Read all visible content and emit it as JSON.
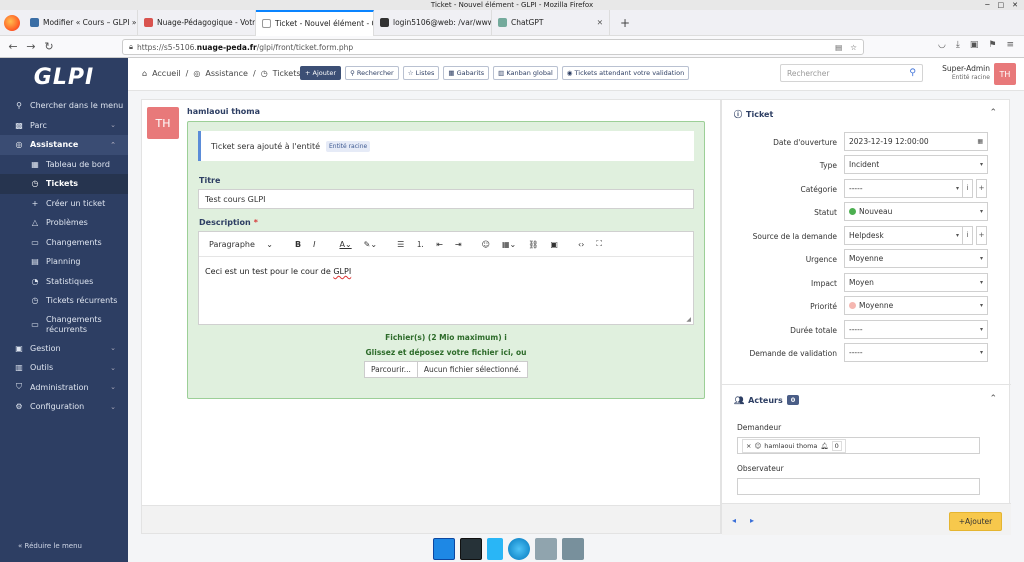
{
  "window": {
    "title": "Ticket - Nouvel élément - GLPI - Mozilla Firefox"
  },
  "browser": {
    "tabs": [
      {
        "label": "Modifier « Cours – GLPI » ‹ s",
        "active": false
      },
      {
        "label": "Nuage-Pédagogique - Votre",
        "active": false
      },
      {
        "label": "Ticket - Nouvel élément - GL",
        "active": true
      },
      {
        "label": "login5106@web: /var/www/",
        "active": false
      },
      {
        "label": "ChatGPT",
        "active": false
      }
    ],
    "url_prefix": "https://s5-5106.",
    "url_domain": "nuage-peda.fr",
    "url_path": "/glpi/front/ticket.form.php"
  },
  "sidebar": {
    "logo": "GLPI",
    "search": "Chercher dans le menu",
    "parc": "Parc",
    "assistance": "Assistance",
    "sub": [
      "Tableau de bord",
      "Tickets",
      "Créer un ticket",
      "Problèmes",
      "Changements",
      "Planning",
      "Statistiques",
      "Tickets récurrents",
      "Changements récurrents"
    ],
    "gestion": "Gestion",
    "outils": "Outils",
    "administration": "Administration",
    "configuration": "Configuration",
    "collapse": "Réduire le menu"
  },
  "header": {
    "breadcrumb": [
      "Accueil",
      "Assistance",
      "Tickets"
    ],
    "actions": [
      "Ajouter",
      "Rechercher",
      "Listes",
      "Gabarits",
      "Kanban global",
      "Tickets attendant votre validation"
    ],
    "search_placeholder": "Rechercher",
    "user_name": "Super-Admin",
    "user_entity": "Entité racine",
    "user_initials": "TH"
  },
  "form": {
    "avatar_initials": "TH",
    "author": "hamlaoui thoma",
    "notice": "Ticket sera ajouté à l'entité",
    "notice_badge": "Entité racine",
    "title_label": "Titre",
    "title_value": "Test cours GLPI",
    "description_label": "Description",
    "required_mark": "*",
    "paragraph": "Paragraphe",
    "editor_text_before": "Ceci est un test pour le cour de ",
    "editor_text_misspelled": "GLPI",
    "files_label": "Fichier(s) (2 Mio maximum)",
    "files_info": "i",
    "drop_text": "Glissez et déposez votre fichier ici, ou",
    "browse": "Parcourir...",
    "no_file": "Aucun fichier sélectionné."
  },
  "ticket_panel": {
    "title": "Ticket",
    "fields": [
      {
        "label": "Date d'ouverture",
        "value": "2023-12-19 12:00:00"
      },
      {
        "label": "Type",
        "value": "Incident"
      },
      {
        "label": "Catégorie",
        "value": "-----"
      },
      {
        "label": "Statut",
        "value": "Nouveau"
      },
      {
        "label": "Source de la demande",
        "value": "Helpdesk"
      },
      {
        "label": "Urgence",
        "value": "Moyenne"
      },
      {
        "label": "Impact",
        "value": "Moyen"
      },
      {
        "label": "Priorité",
        "value": "Moyenne"
      },
      {
        "label": "Durée totale",
        "value": "-----"
      },
      {
        "label": "Demande de validation",
        "value": "-----"
      }
    ],
    "status_color": "#4caf50",
    "priority_color": "#f5b7b1"
  },
  "actors": {
    "title": "Acteurs",
    "count": "0",
    "requester_label": "Demandeur",
    "requester": "hamlaoui thoma",
    "requester_count": "0",
    "observer_label": "Observateur"
  },
  "footer": {
    "add_button": "Ajouter"
  }
}
